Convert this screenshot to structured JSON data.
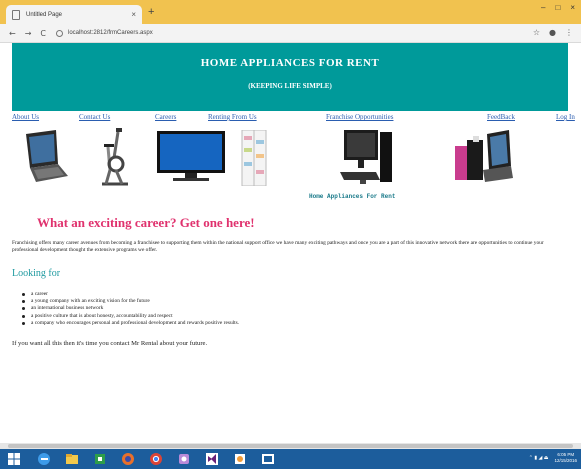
{
  "browser": {
    "tab_title": "Untitled Page",
    "tab_close": "×",
    "new_tab": "+",
    "url": "localhost:2812/frmCareers.aspx",
    "window_controls": [
      "–",
      "□",
      "×"
    ]
  },
  "banner": {
    "title": "HOME APPLIANCES FOR RENT",
    "subtitle": "(KEEPING LIFE SIMPLE)"
  },
  "nav": [
    {
      "label": "About Us"
    },
    {
      "label": "Contact Us"
    },
    {
      "label": "Careers"
    },
    {
      "label": "Renting From Us"
    },
    {
      "label": "Franchise Opportunities"
    },
    {
      "label": "FeedBack"
    },
    {
      "label": "Log In"
    }
  ],
  "products": [
    {
      "name": "laptop-image"
    },
    {
      "name": "exercise-bike-image"
    },
    {
      "name": "television-image"
    },
    {
      "name": "refrigerator-image"
    },
    {
      "name": "desktop-computer-image"
    },
    {
      "name": "appliance-collage-image"
    }
  ],
  "caption": "Home Appliances For Rent",
  "content": {
    "heading": "What an exciting career? Get one here!",
    "intro": "Franchising offers many career avenues from becoming a franchisee to supporting them within the national support office we have many exciting pathways and once you are a part of this innovative network there are opportunities to continue your professional development thought the extensive programs we offer.",
    "looking_for": "Looking for",
    "list": [
      "a career",
      "a young company with an exciting vision for the future",
      "an international business network",
      "a positive culture that is about honesty, accountability and respect",
      "a company who encourages personal and professional development and rewards positive results."
    ],
    "closing": "If you want all this then it's time you contact Mr Rental about your future."
  },
  "taskbar": {
    "time": "6:05 PM",
    "date": "12/15/2016"
  },
  "colors": {
    "banner": "#009a9a",
    "heading": "#e0326e",
    "looking_for": "#1f9aa0",
    "link": "#2a5db0",
    "tabstrip": "#f1c24f",
    "taskbar": "#1c5d9c"
  }
}
